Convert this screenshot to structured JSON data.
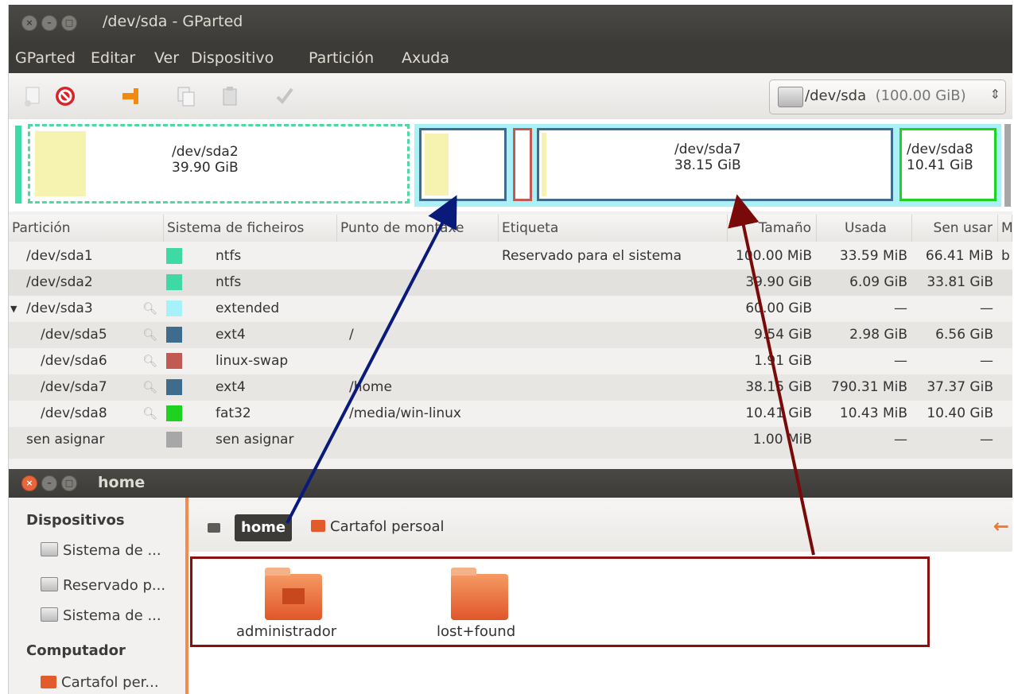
{
  "gparted": {
    "title": "/dev/sda - GParted",
    "menu": [
      "GParted",
      "Editar",
      "Ver",
      "Dispositivo",
      "Partición",
      "Axuda"
    ],
    "device_selector": {
      "device": "/dev/sda",
      "size": "(100.00 GiB)"
    },
    "graph": {
      "sda2": {
        "name": "/dev/sda2",
        "size": "39.90 GiB"
      },
      "sda7": {
        "name": "/dev/sda7",
        "size": "38.15 GiB"
      },
      "sda8": {
        "name": "/dev/sda8",
        "size": "10.41 GiB"
      }
    },
    "columns": [
      "Partición",
      "Sistema de ficheiros",
      "Punto de montaxe",
      "Etiqueta",
      "Tamaño",
      "Usada",
      "Sen usar",
      "M"
    ],
    "rows": [
      {
        "partition": "/dev/sda1",
        "color": "#3fd9a6",
        "fs": "ntfs",
        "mount": "",
        "label": "Reservado para el sistema",
        "size": "100.00 MiB",
        "used": "33.59 MiB",
        "unused": "66.41 MiB",
        "flags": "b"
      },
      {
        "partition": "/dev/sda2",
        "color": "#3fd9a6",
        "fs": "ntfs",
        "mount": "",
        "label": "",
        "size": "39.90 GiB",
        "used": "6.09 GiB",
        "unused": "33.81 GiB",
        "flags": ""
      },
      {
        "partition": "/dev/sda3",
        "color": "#a6f2f8",
        "fs": "extended",
        "mount": "",
        "label": "",
        "size": "60.00 GiB",
        "used": "—",
        "unused": "—",
        "flags": ""
      },
      {
        "partition": "/dev/sda5",
        "color": "#3f6b8c",
        "fs": "ext4",
        "mount": "/",
        "label": "",
        "size": "9.54 GiB",
        "used": "2.98 GiB",
        "unused": "6.56 GiB",
        "flags": ""
      },
      {
        "partition": "/dev/sda6",
        "color": "#c05a52",
        "fs": "linux-swap",
        "mount": "",
        "label": "",
        "size": "1.91 GiB",
        "used": "—",
        "unused": "—",
        "flags": ""
      },
      {
        "partition": "/dev/sda7",
        "color": "#3f6b8c",
        "fs": "ext4",
        "mount": "/home",
        "label": "",
        "size": "38.15 GiB",
        "used": "790.31 MiB",
        "unused": "37.37 GiB",
        "flags": ""
      },
      {
        "partition": "/dev/sda8",
        "color": "#1fd21f",
        "fs": "fat32",
        "mount": "/media/win-linux",
        "label": "",
        "size": "10.41 GiB",
        "used": "10.43 MiB",
        "unused": "10.40 GiB",
        "flags": ""
      },
      {
        "partition": "sen asignar",
        "color": "#a7a7a7",
        "fs": "sen asignar",
        "mount": "",
        "label": "",
        "size": "1.00 MiB",
        "used": "—",
        "unused": "—",
        "flags": ""
      }
    ]
  },
  "files": {
    "title": "home",
    "sidebar": {
      "devices_heading": "Dispositivos",
      "devices": [
        "Sistema de ...",
        "Reservado p...",
        "Sistema de ..."
      ],
      "computer_heading": "Computador",
      "computer": [
        "Cartafol per..."
      ]
    },
    "path": {
      "current": "home",
      "parent": "Cartafol persoal"
    },
    "items": [
      "administrador",
      "lost+found"
    ]
  },
  "colors": {
    "annotation_blue": "#0a1a7a",
    "annotation_red": "#7a0a0a",
    "highlight_box": "#8a1010"
  }
}
